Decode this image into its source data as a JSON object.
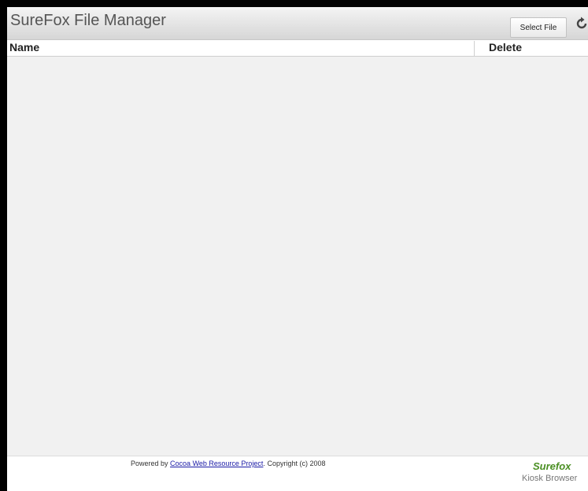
{
  "header": {
    "title": "SureFox File Manager",
    "select_file_label": "Select File",
    "refresh_icon": "refresh-icon"
  },
  "table": {
    "columns": [
      "Name",
      "Delete"
    ],
    "rows": []
  },
  "footer": {
    "powered_prefix": "Powered by",
    "link_text": "Cocoa Web Resource Project",
    "copyright": ". Copyright (c) 2008",
    "brand_logo": "Surefox",
    "brand_sub": "Kiosk Browser"
  },
  "colors": {
    "header_gradient_top": "#f4f4f4",
    "header_gradient_bottom": "#d6d6d6",
    "list_background": "#f1f1f1",
    "link": "#1a1aa6",
    "brand": "#4a8f23"
  }
}
